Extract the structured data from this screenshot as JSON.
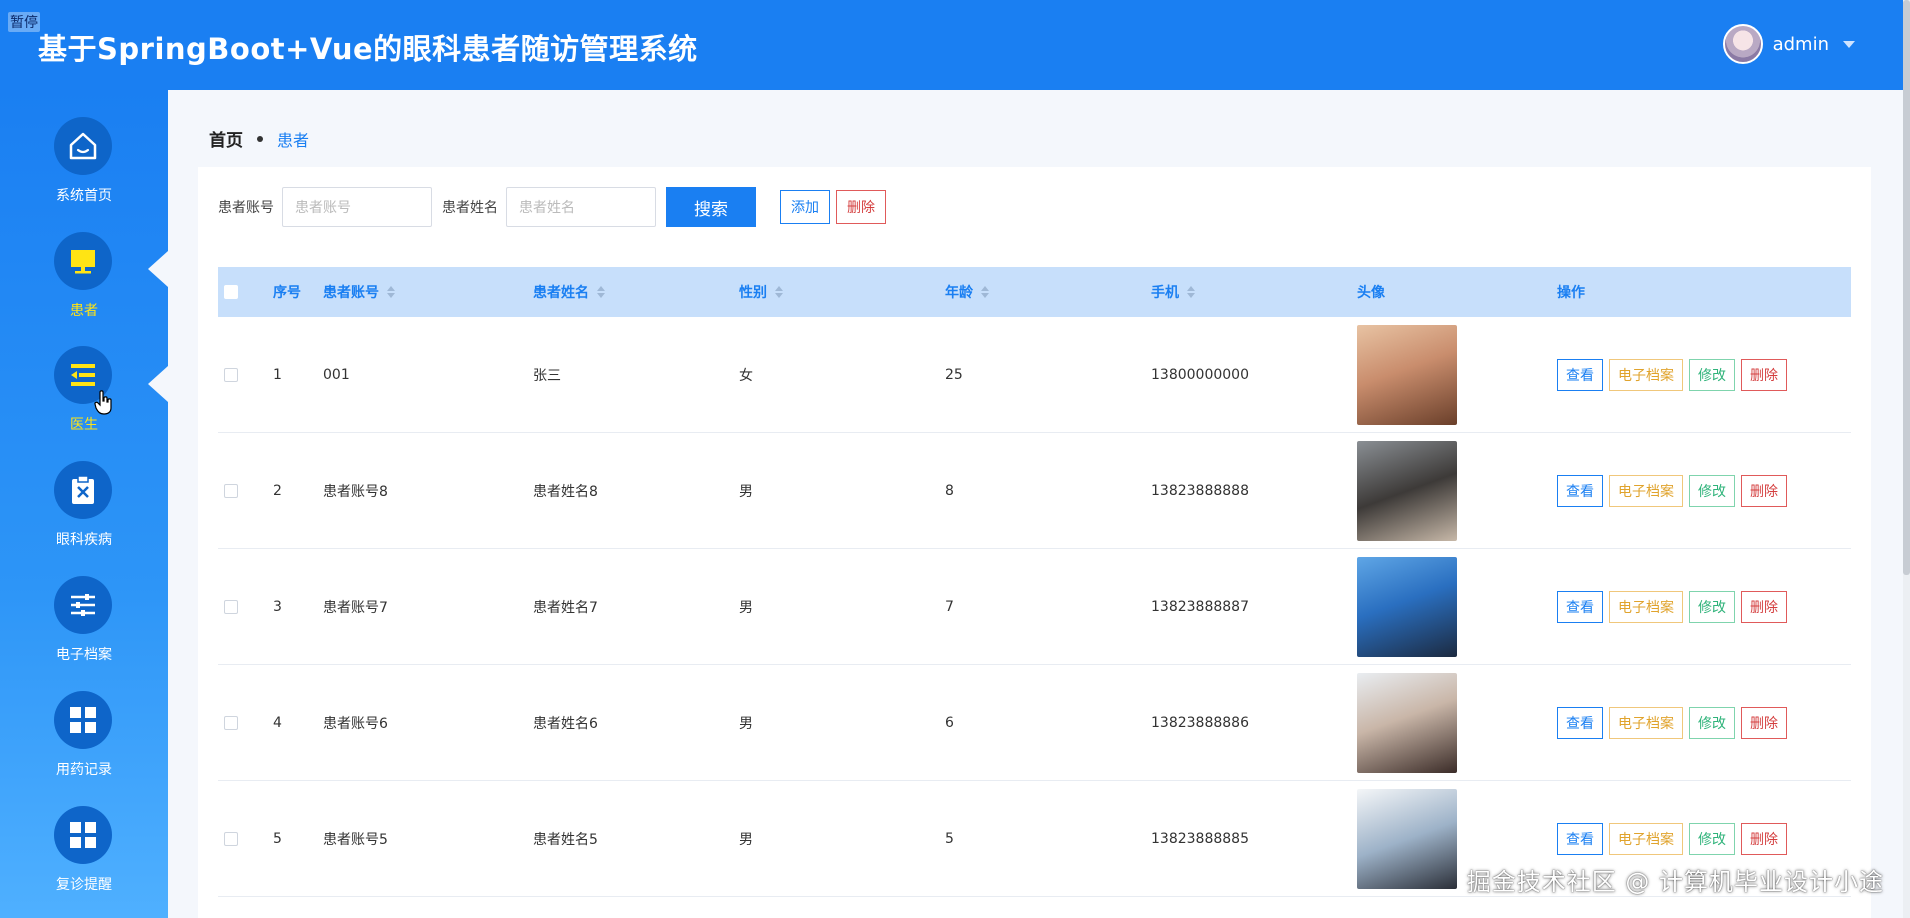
{
  "header": {
    "pause_tag": "暂停",
    "title": "基于SpringBoot+Vue的眼科患者随访管理系统",
    "username": "admin"
  },
  "sidebar": {
    "items": [
      {
        "label": "系统首页",
        "icon": "home-icon"
      },
      {
        "label": "患者",
        "icon": "monitor-icon",
        "active": true
      },
      {
        "label": "医生",
        "icon": "list-indent-icon",
        "active": true
      },
      {
        "label": "眼科疾病",
        "icon": "clipboard-x-icon"
      },
      {
        "label": "电子档案",
        "icon": "sliders-icon"
      },
      {
        "label": "用药记录",
        "icon": "grid-icon"
      },
      {
        "label": "复诊提醒",
        "icon": "grid-icon"
      }
    ]
  },
  "breadcrumb": {
    "home": "首页",
    "current": "患者"
  },
  "search": {
    "account_label": "患者账号",
    "account_placeholder": "患者账号",
    "name_label": "患者姓名",
    "name_placeholder": "患者姓名",
    "search_button": "搜索",
    "add_button": "添加",
    "delete_button": "删除"
  },
  "table": {
    "headers": [
      "序号",
      "患者账号",
      "患者姓名",
      "性别",
      "年龄",
      "手机",
      "头像",
      "操作"
    ],
    "rows": [
      {
        "no": "1",
        "account": "001",
        "name": "张三",
        "sex": "女",
        "age": "25",
        "phone": "13800000000"
      },
      {
        "no": "2",
        "account": "患者账号8",
        "name": "患者姓名8",
        "sex": "男",
        "age": "8",
        "phone": "13823888888"
      },
      {
        "no": "3",
        "account": "患者账号7",
        "name": "患者姓名7",
        "sex": "男",
        "age": "7",
        "phone": "13823888887"
      },
      {
        "no": "4",
        "account": "患者账号6",
        "name": "患者姓名6",
        "sex": "男",
        "age": "6",
        "phone": "13823888886"
      },
      {
        "no": "5",
        "account": "患者账号5",
        "name": "患者姓名5",
        "sex": "男",
        "age": "5",
        "phone": "13823888885"
      }
    ],
    "ops": {
      "view": "查看",
      "record": "电子档案",
      "edit": "修改",
      "delete": "删除"
    }
  },
  "watermark": "掘金技术社区 @ 计算机毕业设计小途",
  "colors": {
    "primary": "#1a7ff2",
    "active_nav": "#ffe414",
    "danger": "#d43f3f",
    "warning": "#e0a32c",
    "success": "#2fb37a"
  }
}
